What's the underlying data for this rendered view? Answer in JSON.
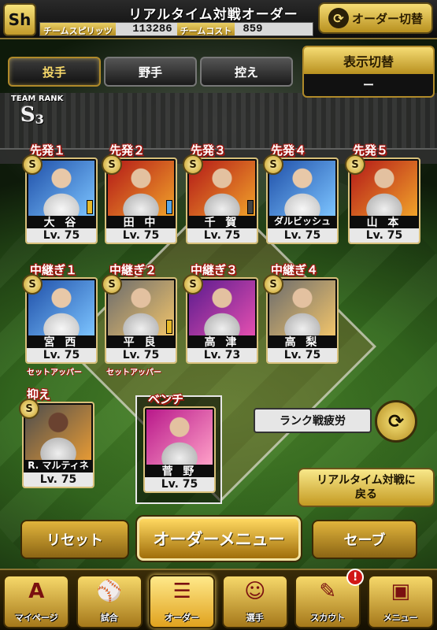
{
  "header": {
    "logo_text": "Sh",
    "title": "リアルタイム対戦オーダー",
    "team_spirit_label": "チームスピリッツ",
    "team_spirit_value": "113286",
    "team_cost_label": "チームコスト",
    "team_cost_value": "859",
    "order_switch_label": "オーダー切替"
  },
  "tabs": [
    {
      "label": "投手",
      "active": true
    },
    {
      "label": "野手",
      "active": false
    },
    {
      "label": "控え",
      "active": false
    }
  ],
  "display_switch": {
    "label": "表示切替",
    "value": "ー"
  },
  "team_rank": {
    "label": "TEAM RANK",
    "value": "S",
    "sub": "3"
  },
  "starters": [
    {
      "role": "先発１",
      "name": "大 谷",
      "level": "Lv. 75"
    },
    {
      "role": "先発２",
      "name": "田 中",
      "level": "Lv. 75"
    },
    {
      "role": "先発３",
      "name": "千 賀",
      "level": "Lv. 75"
    },
    {
      "role": "先発４",
      "name": "ダルビッシュ",
      "level": "Lv. 75"
    },
    {
      "role": "先発５",
      "name": "山 本",
      "level": "Lv. 75"
    }
  ],
  "relievers": [
    {
      "role": "中継ぎ１",
      "name": "宮 西",
      "level": "Lv. 75",
      "sub_role": "セットアッパー"
    },
    {
      "role": "中継ぎ２",
      "name": "平 良",
      "level": "Lv. 75",
      "sub_role": "セットアッパー"
    },
    {
      "role": "中継ぎ３",
      "name": "高 津",
      "level": "Lv. 73"
    },
    {
      "role": "中継ぎ４",
      "name": "高 梨",
      "level": "Lv. 75"
    }
  ],
  "closer": {
    "role": "抑え",
    "name": "R. マルティネス",
    "level": "Lv. 75"
  },
  "bench": {
    "role": "ベンチ",
    "name": "菅 野",
    "level": "Lv. 75"
  },
  "fatigue_label": "ランク戦疲労",
  "back_button": {
    "line1": "リアルタイム対戦に",
    "line2": "戻る"
  },
  "actions": {
    "reset": "リセット",
    "menu": "オーダーメニュー",
    "save": "セーブ"
  },
  "nav": [
    {
      "label": "マイページ",
      "icon": "A"
    },
    {
      "label": "試合",
      "icon": "⚾"
    },
    {
      "label": "オーダー",
      "icon": "☰"
    },
    {
      "label": "選手",
      "icon": "☺"
    },
    {
      "label": "スカウト",
      "icon": "✎",
      "alert": "!"
    },
    {
      "label": "メニュー",
      "icon": "▣"
    }
  ]
}
